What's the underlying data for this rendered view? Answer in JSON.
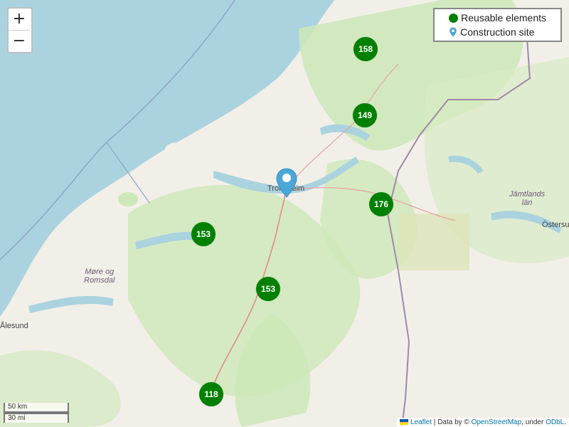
{
  "zoom": {
    "in_label": "+",
    "out_label": "−"
  },
  "legend": {
    "reusable_label": "Reusable elements",
    "reusable_color": "#008000",
    "construction_label": "Construction site",
    "construction_color": "#4aa7d8"
  },
  "clusters": [
    {
      "count": "158"
    },
    {
      "count": "149"
    },
    {
      "count": "176"
    },
    {
      "count": "153"
    },
    {
      "count": "153"
    },
    {
      "count": "118"
    }
  ],
  "places": {
    "trondheim": "Trondheim",
    "alesund": "Ålesund",
    "ostersund": "Östersund",
    "more_og_romsdal_1": "Møre og",
    "more_og_romsdal_2": "Romsdal",
    "jamtlands_1": "Jämtlands",
    "jamtlands_2": "län"
  },
  "scale": {
    "km": "50 km",
    "mi": "30 mi"
  },
  "attribution": {
    "leaflet": "Leaflet",
    "data_by": " | Data by © ",
    "osm": "OpenStreetMap",
    "under": ", under ",
    "odbl": "ODbL",
    "end": "."
  },
  "colors": {
    "sea": "#aad3df",
    "land": "#f2efe9",
    "forest": "#cde8b8",
    "water": "#aad3df",
    "border": "#9e8aa8"
  }
}
